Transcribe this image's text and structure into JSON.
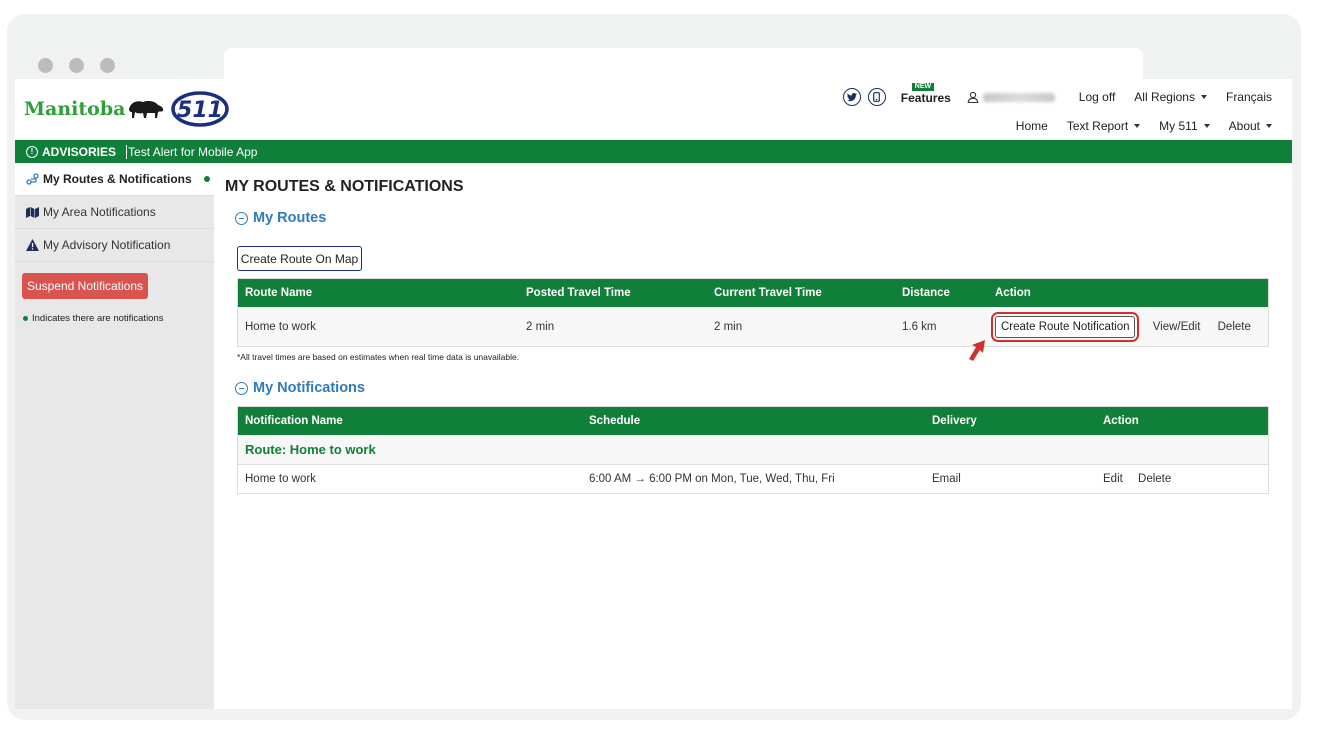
{
  "header": {
    "logo_text": "Manitoba",
    "logo_511": "511",
    "new_badge": "NEW",
    "features": "Features",
    "log_off": "Log off",
    "all_regions": "All Regions",
    "francais": "Français",
    "home": "Home",
    "text_report": "Text Report",
    "my511": "My 511",
    "about": "About"
  },
  "advisory": {
    "label": "ADVISORIES",
    "message": "Test Alert for Mobile App"
  },
  "sidebar": {
    "items": [
      {
        "label": "My Routes & Notifications"
      },
      {
        "label": "My Area Notifications"
      },
      {
        "label": "My Advisory Notification"
      }
    ],
    "suspend_label": "Suspend Notifications",
    "legend": "Indicates there are notifications"
  },
  "main": {
    "title": "MY ROUTES & NOTIFICATIONS",
    "routes_heading": "My Routes",
    "create_map_button": "Create Route On Map",
    "routes_table": {
      "headers": [
        "Route Name",
        "Posted Travel Time",
        "Current Travel Time",
        "Distance",
        "Action"
      ],
      "rows": [
        {
          "name": "Home to work",
          "posted": "2 min",
          "current": "2 min",
          "distance": "1.6 km",
          "create": "Create Route Notification",
          "view": "View/Edit",
          "delete": "Delete"
        }
      ]
    },
    "note": "*All travel times are based on estimates when real time data is unavailable.",
    "notifications_heading": "My Notifications",
    "notifications_table": {
      "headers": [
        "Notification Name",
        "Schedule",
        "Delivery",
        "Action"
      ],
      "group": "Route: Home to work",
      "rows": [
        {
          "name": "Home to work",
          "schedule": "6:00 AM → 6:00 PM on Mon, Tue, Wed, Thu, Fri",
          "delivery": "Email",
          "edit": "Edit",
          "delete": "Delete"
        }
      ]
    }
  },
  "colors": {
    "green": "#107f3a",
    "blue": "#2e7bbe",
    "red": "#d9534f",
    "navy": "#1d2e5e"
  }
}
